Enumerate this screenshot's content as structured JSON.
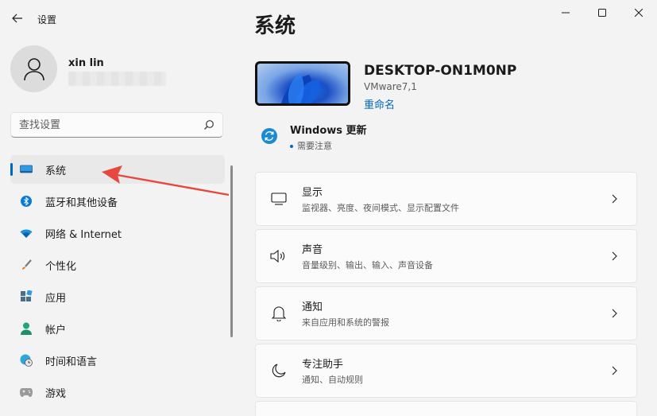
{
  "app": {
    "title": "设置"
  },
  "user": {
    "name": "xin lin"
  },
  "search": {
    "placeholder": "查找设置"
  },
  "nav": {
    "items": [
      {
        "label": "系统",
        "icon": "display-icon",
        "active": true
      },
      {
        "label": "蓝牙和其他设备",
        "icon": "bluetooth-icon"
      },
      {
        "label": "网络 & Internet",
        "icon": "wifi-icon"
      },
      {
        "label": "个性化",
        "icon": "brush-icon"
      },
      {
        "label": "应用",
        "icon": "apps-icon"
      },
      {
        "label": "帐户",
        "icon": "person-icon"
      },
      {
        "label": "时间和语言",
        "icon": "globe-clock-icon"
      },
      {
        "label": "游戏",
        "icon": "gamepad-icon"
      }
    ]
  },
  "main": {
    "title": "系统",
    "device": {
      "name": "DESKTOP-ON1M0NP",
      "model": "VMware7,1",
      "rename": "重命名"
    },
    "update": {
      "title": "Windows 更新",
      "status": "需要注意"
    },
    "cards": [
      {
        "title": "显示",
        "desc": "监视器、亮度、夜间模式、显示配置文件",
        "icon": "monitor-icon"
      },
      {
        "title": "声音",
        "desc": "音量级别、输出、输入、声音设备",
        "icon": "speaker-icon"
      },
      {
        "title": "通知",
        "desc": "来自应用和系统的警报",
        "icon": "bell-icon"
      },
      {
        "title": "专注助手",
        "desc": "通知、自动规则",
        "icon": "moon-icon"
      }
    ]
  },
  "colors": {
    "accent": "#0067c0",
    "annotation": "#e8473f"
  }
}
